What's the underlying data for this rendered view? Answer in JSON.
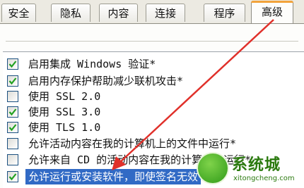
{
  "tabs": [
    {
      "label": "安全"
    },
    {
      "label": "隐私"
    },
    {
      "label": "内容"
    },
    {
      "label": "连接"
    },
    {
      "label": "程序"
    },
    {
      "label": "高级",
      "active": true
    }
  ],
  "settings": [
    {
      "label": "启用集成 Windows 验证*",
      "checked": true
    },
    {
      "label": "启用内存保护帮助减少联机攻击*",
      "checked": true
    },
    {
      "label": "使用 SSL 2.0",
      "checked": false
    },
    {
      "label": "使用 SSL 3.0",
      "checked": true
    },
    {
      "label": "使用 TLS 1.0",
      "checked": true
    },
    {
      "label": "允许活动内容在我的计算机上的文件中运行*",
      "checked": false
    },
    {
      "label": "允许来自 CD 的活动内容在我的计算机上运行*",
      "checked": false
    },
    {
      "label": "允许运行或安装软件，即使签名无效",
      "checked": true,
      "selected": true
    }
  ],
  "watermark": {
    "brand": "系统城",
    "url": "xitongcheng.com"
  },
  "colors": {
    "accent_tab": "#f2a33a",
    "selection": "#316ac5",
    "checkmark": "#21a121",
    "arrow": "#e0302a"
  }
}
